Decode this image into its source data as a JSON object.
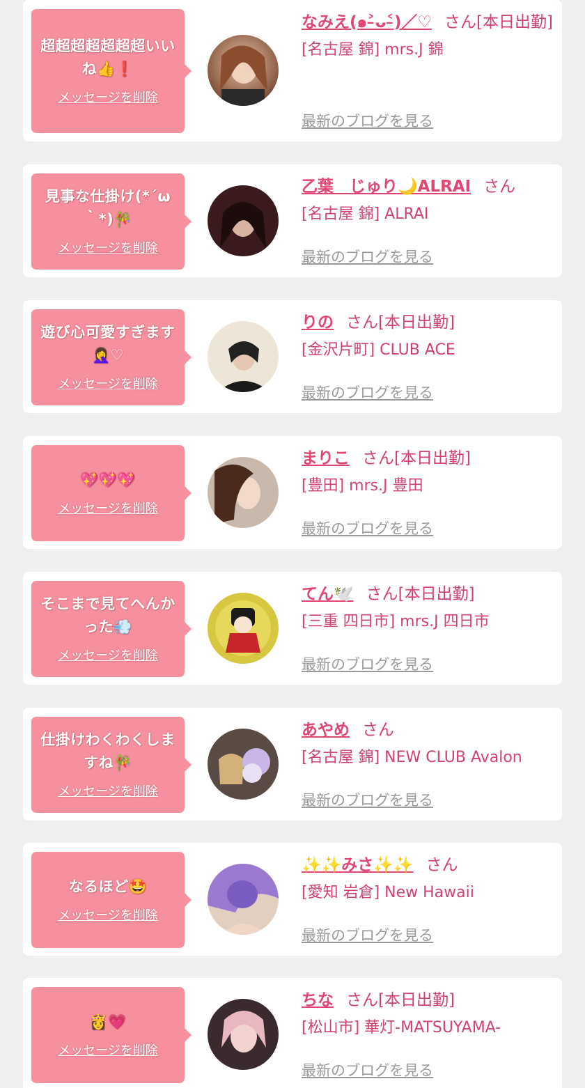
{
  "colors": {
    "page_bg": "#efefef",
    "card_bg": "#ffffff",
    "bubble_bg": "#f7909e",
    "name_pink": "#e0466f",
    "text_pink": "#d14270",
    "link_gray": "#9a9a9a"
  },
  "delete_label": "メッセージを削除",
  "blog_label": "最新のブログを見る",
  "cards": [
    {
      "message": "超超超超超超超いいね👍❗",
      "name": "なみえ(๑˃̵ᴗ˂̵)／♡",
      "suffix": "さん[本日出勤]",
      "shop": "[名古屋 錦] mrs.J 錦",
      "avatar_icon": "avatar-photo"
    },
    {
      "message": "見事な仕掛け(*´ω｀*)🎋",
      "name": "乙葉　じゅり🌙ALRAI",
      "suffix": "さん",
      "shop": "[名古屋 錦] ALRAI",
      "avatar_icon": "avatar-photo"
    },
    {
      "message": "遊び心可愛すぎます🤦‍♀️♡",
      "name": "りの",
      "suffix": "さん[本日出勤]",
      "shop": "[金沢片町] CLUB ACE",
      "avatar_icon": "avatar-photo"
    },
    {
      "message": "💖💖💖",
      "name": "まりこ",
      "suffix": "さん[本日出勤]",
      "shop": "[豊田] mrs.J 豊田",
      "avatar_icon": "avatar-photo"
    },
    {
      "message": "そこまで見てへんかった💨",
      "name": "てん🕊️",
      "suffix": "さん[本日出勤]",
      "shop": "[三重 四日市] mrs.J 四日市",
      "avatar_icon": "avatar-illustration"
    },
    {
      "message": "仕掛けわくわくしますね🎋",
      "name": "あやめ",
      "suffix": "さん",
      "shop": "[名古屋 錦] NEW CLUB Avalon",
      "avatar_icon": "avatar-photo"
    },
    {
      "message": "なるほど🤩",
      "name": "✨✨みさ✨✨",
      "suffix": "さん",
      "shop": "[愛知 岩倉] New Hawaii",
      "avatar_icon": "avatar-photo"
    },
    {
      "message": "👸💗",
      "name": "ちな",
      "suffix": "さん[本日出勤]",
      "shop": "[松山市] 華灯-MATSUYAMA-",
      "avatar_icon": "avatar-photo"
    }
  ]
}
